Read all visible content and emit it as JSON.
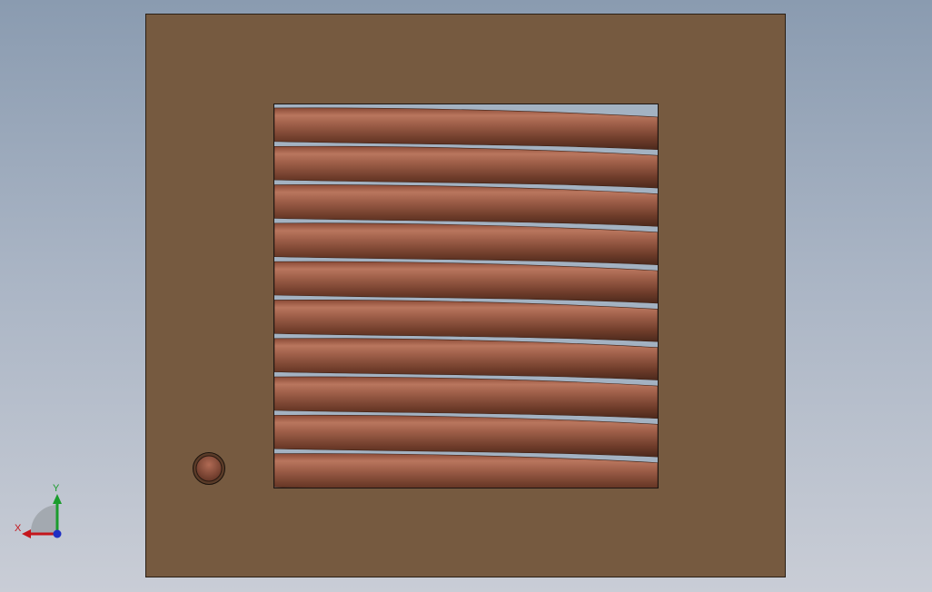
{
  "colors": {
    "background_top": "#8a9bb0",
    "background_bottom": "#c9cdd6",
    "plate": "#765a40",
    "coil_light": "#b4705a",
    "coil_mid": "#96553f",
    "coil_dark": "#5a3122",
    "axis_x": "#c4161c",
    "axis_y": "#1a9c2c",
    "axis_z": "#1f2fc4"
  },
  "scene": {
    "coil_turns": 10
  },
  "triad": {
    "x_label": "X",
    "y_label": "Y"
  }
}
